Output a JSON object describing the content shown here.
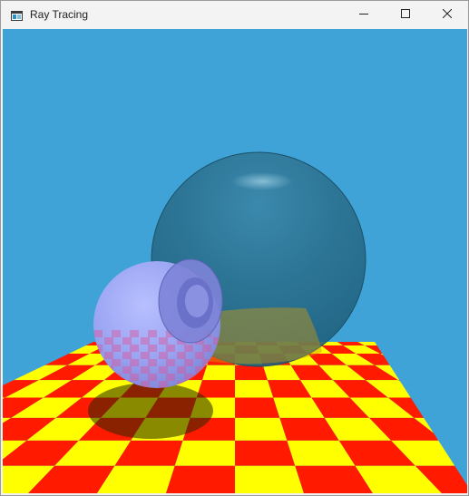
{
  "window": {
    "title": "Ray Tracing",
    "icons": {
      "app": "app-window-icon",
      "minimize": "minimize-icon",
      "maximize": "maximize-icon",
      "close": "close-icon"
    }
  },
  "scene": {
    "sky_color": "#40a3d7",
    "floor_colors": [
      "#ffff00",
      "#ff1a00"
    ],
    "floor_shadow_color": "#6e6e00",
    "large_sphere_color": "#2a6e8c",
    "small_sphere_color": "#9aa4f2"
  }
}
